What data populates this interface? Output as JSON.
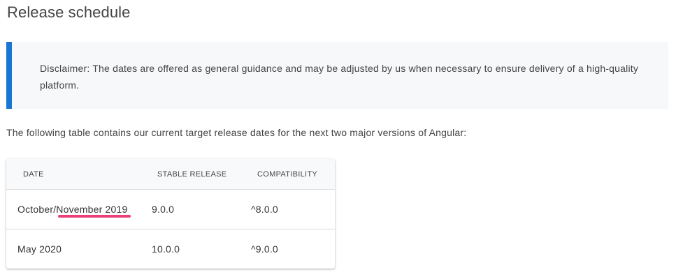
{
  "page": {
    "title": "Release schedule",
    "disclaimer": "Disclaimer: The dates are offered as general guidance and may be adjusted by us when necessary to ensure delivery of a high-quality platform.",
    "intro": "The following table contains our current target release dates for the next two major versions of Angular:",
    "accent_color": "#1976d2",
    "highlight_color": "#ec407a"
  },
  "table": {
    "headers": [
      "DATE",
      "STABLE RELEASE",
      "COMPATIBILITY"
    ],
    "rows": [
      [
        "October/November 2019",
        "9.0.0",
        "^8.0.0"
      ],
      [
        "May 2020",
        "10.0.0",
        "^9.0.0"
      ]
    ]
  }
}
